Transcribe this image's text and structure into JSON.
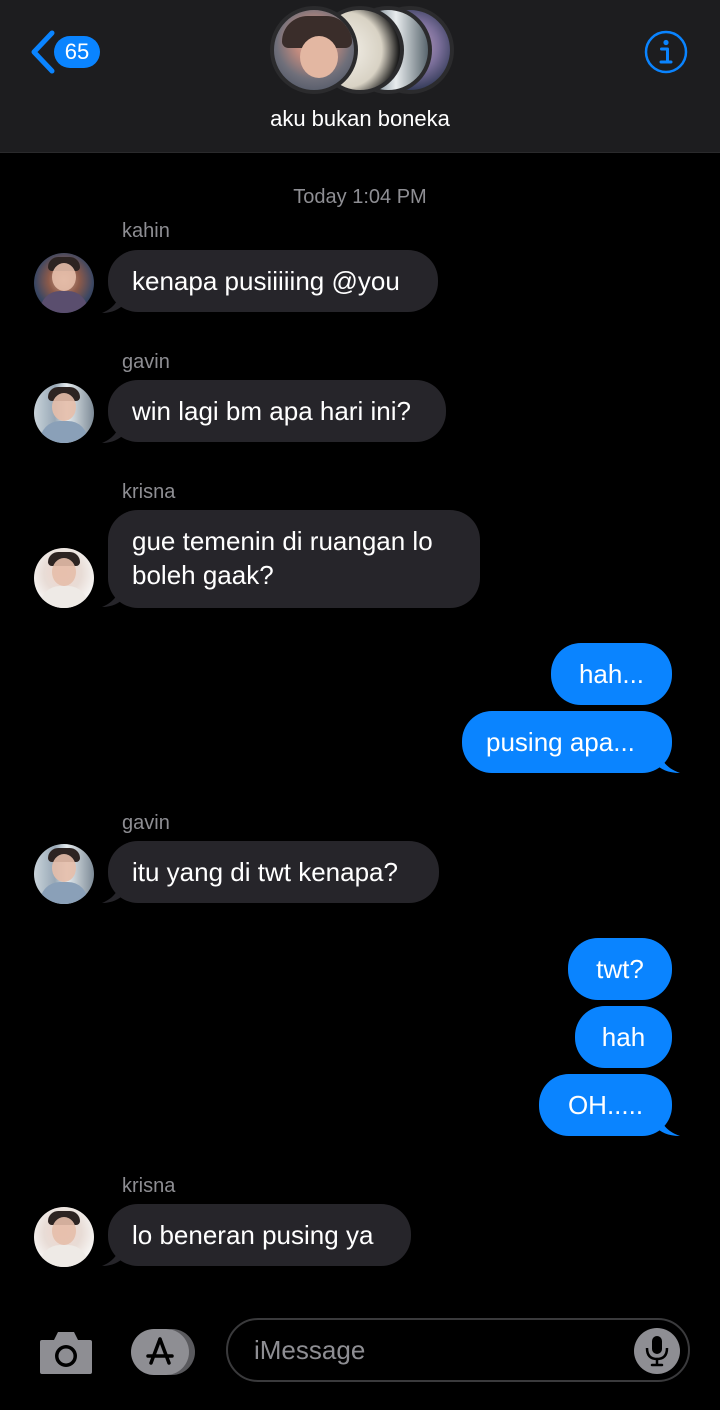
{
  "header": {
    "back_badge": "65",
    "group_name": "aku bukan boneka",
    "info_icon": "info-icon",
    "back_icon": "chevron-left-icon"
  },
  "thread": {
    "timestamp": "Today 1:04 PM",
    "senders": {
      "s1": "kahin",
      "s2": "gavin",
      "s3": "krisna",
      "s4": "gavin",
      "s5": "krisna"
    },
    "messages": {
      "m1": "kenapa pusiiiiing @you",
      "m2": "win lagi bm apa hari ini?",
      "m3_line1": "gue temenin di ruangan lo",
      "m3_line2": "boleh gaak?",
      "m4": "hah...",
      "m5": "pusing apa...",
      "m6": "itu yang di twt kenapa?",
      "m7": "twt?",
      "m8": "hah",
      "m9": "OH.....",
      "m10": "lo beneran pusing ya"
    }
  },
  "composer": {
    "placeholder": "iMessage",
    "camera_icon": "camera-icon",
    "apps_icon": "app-store-icon",
    "mic_icon": "microphone-icon"
  },
  "colors": {
    "accent": "#0a84ff",
    "incoming_bubble": "#26252a",
    "outgoing_bubble": "#0a84ff",
    "background": "#000000",
    "header_bg": "#1d1d1f",
    "secondary_text": "#8e8e93"
  }
}
